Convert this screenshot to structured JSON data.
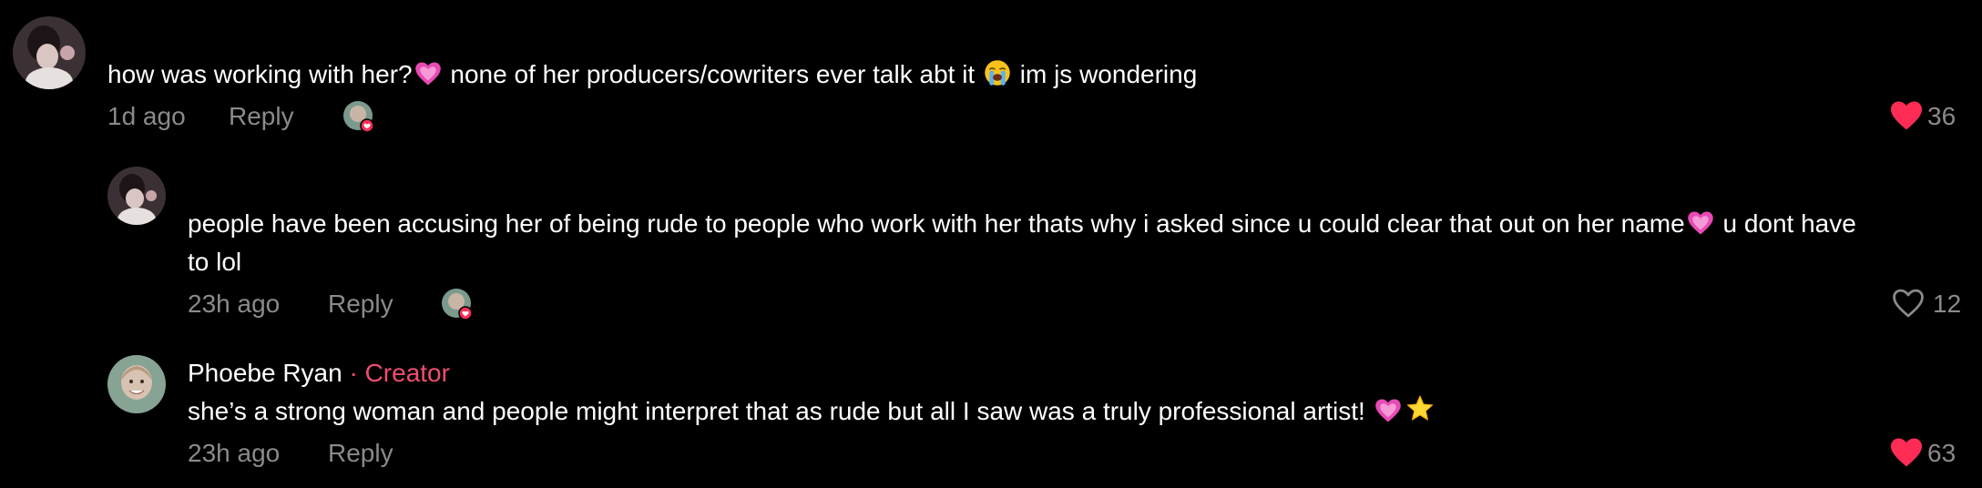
{
  "comments": [
    {
      "text_before": "how was working with her?",
      "text_mid": " none of her producers/cowriters ever talk abt it ",
      "text_after": " im js wondering",
      "time": "1d ago",
      "reply": "Reply",
      "likes": "36",
      "liked": true
    },
    {
      "text_line1": "people have been accusing her of being rude to people who work with her thats why i asked since u could clear that out on her name",
      "text_line1_after": " u dont have",
      "text_line2": "to lol",
      "time": "23h ago",
      "reply": "Reply",
      "likes": "12",
      "liked": false
    },
    {
      "username": "Phoebe Ryan",
      "badge": " · Creator",
      "text": "she’s a strong woman and people might interpret that as rude but all I saw was a truly professional artist! ",
      "time": "23h ago",
      "reply": "Reply",
      "likes": "63",
      "liked": true
    }
  ],
  "colors": {
    "background": "#000000",
    "muted_text": "#8a8a8a",
    "creator": "#f04d6e",
    "liked_heart": "#fe2c55"
  },
  "icons": [
    "heart-filled-icon",
    "heart-outline-icon",
    "pink-heart-emoji",
    "loudly-crying-face-emoji",
    "star-emoji"
  ]
}
